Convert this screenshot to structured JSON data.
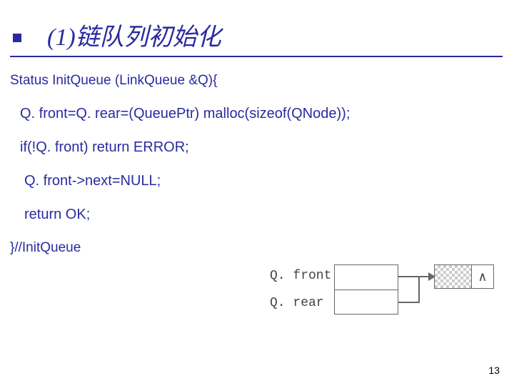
{
  "title": "(1)链队列初始化",
  "code": {
    "sig": "Status InitQueue (LinkQueue &Q){",
    "line1": "Q. front=Q. rear=(QueuePtr) malloc(sizeof(QNode));",
    "line2": "if(!Q. front) return ERROR;",
    "line3": "Q. front->next=NULL;",
    "line4": "return OK;",
    "closing": "}//InitQueue"
  },
  "diagram": {
    "label_front": "Q. front",
    "label_rear": "Q. rear",
    "null_symbol": "∧"
  },
  "page_number": "13"
}
